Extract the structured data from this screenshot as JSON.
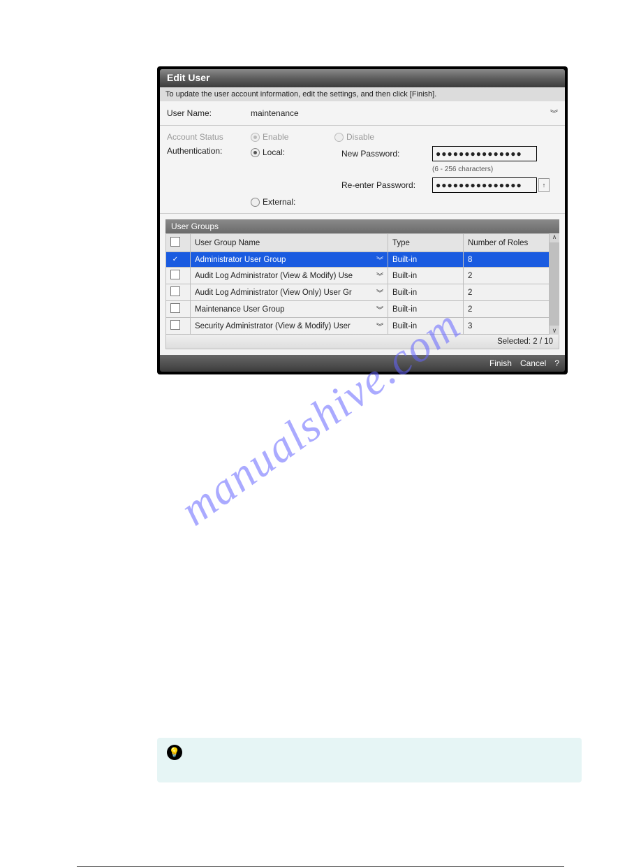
{
  "dialog": {
    "title": "Edit User",
    "instruction": "To update the user account information, edit the settings, and then click [Finish].",
    "userNameLabel": "User Name:",
    "userNameValue": "maintenance",
    "accountStatusLabel": "Account Status",
    "enableLabel": "Enable",
    "disableLabel": "Disable",
    "authenticationLabel": "Authentication:",
    "localLabel": "Local:",
    "externalLabel": "External:",
    "newPasswordLabel": "New Password:",
    "reenterPasswordLabel": "Re-enter Password:",
    "passwordHint": "(6 - 256 characters)",
    "passwordMask": "●●●●●●●●●●●●●●●"
  },
  "groups": {
    "sectionTitle": "User Groups",
    "headers": {
      "name": "User Group Name",
      "type": "Type",
      "roles": "Number of Roles"
    },
    "rows": [
      {
        "checked": true,
        "name": "Administrator User Group",
        "type": "Built-in",
        "roles": "8"
      },
      {
        "checked": false,
        "name": "Audit Log Administrator (View & Modify) Use",
        "type": "Built-in",
        "roles": "2"
      },
      {
        "checked": false,
        "name": "Audit Log Administrator (View Only) User Gr",
        "type": "Built-in",
        "roles": "2"
      },
      {
        "checked": false,
        "name": "Maintenance User Group",
        "type": "Built-in",
        "roles": "2"
      },
      {
        "checked": false,
        "name": "Security Administrator (View & Modify) User",
        "type": "Built-in",
        "roles": "3"
      }
    ],
    "countText": "Selected: 2 / 10"
  },
  "footer": {
    "finish": "Finish",
    "cancel": "Cancel",
    "help": "?"
  },
  "watermark": "manualshive.com",
  "tip": {
    "icon": "💡",
    "text": ""
  }
}
